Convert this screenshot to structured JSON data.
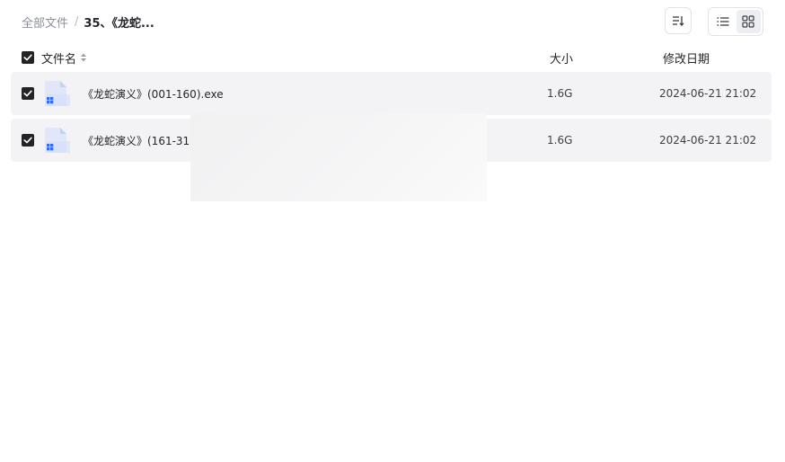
{
  "breadcrumb": {
    "root": "全部文件",
    "separator": "/",
    "current": "35、《龙蛇..."
  },
  "toolbar": {
    "sort_icon": "sort-lines-icon",
    "view_list_icon": "list-view-icon",
    "view_grid_icon": "grid-view-icon",
    "active_view": "list"
  },
  "table": {
    "columns": {
      "name": "文件名",
      "size": "大小",
      "modified": "修改日期"
    },
    "select_all_checked": true,
    "rows": [
      {
        "name": "《龙蛇演义》(001-160).exe",
        "size": "1.6G",
        "modified": "2024-06-21 21:02",
        "checked": true,
        "icon": "exe-file-icon"
      },
      {
        "name": "《龙蛇演义》(161-319",
        "size": "1.6G",
        "modified": "2024-06-21 21:02",
        "checked": true,
        "icon": "exe-file-icon"
      }
    ]
  },
  "colors": {
    "row_background": "#f3f3f5",
    "checkbox": "#222326",
    "file_icon_accent": "#3a6ee8"
  }
}
